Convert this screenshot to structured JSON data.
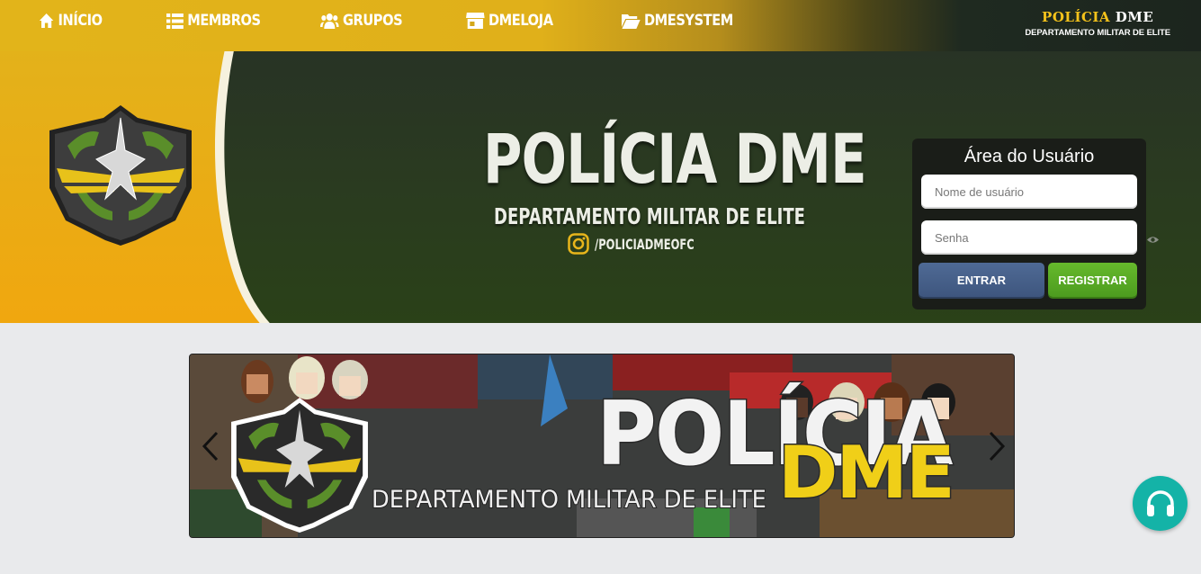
{
  "nav": {
    "items": [
      {
        "label": "INÍCIO",
        "icon": "home-icon"
      },
      {
        "label": "MEMBROS",
        "icon": "list-icon"
      },
      {
        "label": "GRUPOS",
        "icon": "users-icon"
      },
      {
        "label": "DMELOJA",
        "icon": "store-icon"
      },
      {
        "label": "DMESYSTEM",
        "icon": "folder-open-icon"
      }
    ],
    "brand": {
      "title_part1": "POLÍCIA",
      "title_part2": "DME",
      "subtitle": "DEPARTAMENTO MILITAR DE ELITE"
    }
  },
  "hero": {
    "title": "POLÍCIA DME",
    "subtitle": "DEPARTAMENTO MILITAR DE ELITE",
    "instagram": "/POLICIADMEOFC"
  },
  "login": {
    "title": "Área do Usuário",
    "username_placeholder": "Nome de usuário",
    "password_placeholder": "Senha",
    "enter_label": "ENTRAR",
    "register_label": "REGISTRAR"
  },
  "banner": {
    "title": "POLÍCIA",
    "title_accent": "DME",
    "subtitle": "DEPARTAMENTO MILITAR DE ELITE"
  },
  "colors": {
    "accent_yellow": "#e2b41a",
    "dark_green": "#2a3b20",
    "enter_blue": "#4f6a95",
    "register_green": "#5cac25",
    "support_teal": "#14b3a7"
  }
}
